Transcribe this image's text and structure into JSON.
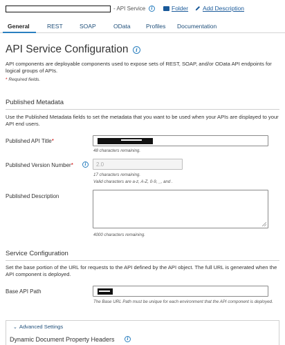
{
  "header": {
    "title_suffix": "- API Service",
    "folder_link": "Folder",
    "add_description_link": "Add Description"
  },
  "tabs": [
    {
      "label": "General",
      "active": true
    },
    {
      "label": "REST"
    },
    {
      "label": "SOAP"
    },
    {
      "label": "OData"
    },
    {
      "label": "Profiles"
    },
    {
      "label": "Documentation"
    }
  ],
  "page": {
    "title": "API Service Configuration",
    "intro": "API components are deployable components used to expose sets of REST, SOAP, and/or OData API endpoints for logical groups of APIs.",
    "required_note": "Required fields."
  },
  "published_metadata": {
    "heading": "Published Metadata",
    "description": "Use the Published Metadata fields to set the metadata that you want to be used when your APIs are displayed to your API end users.",
    "api_title_label": "Published API Title",
    "api_title_hint": "48 characters remaining.",
    "version_label": "Published Version Number",
    "version_value": "2.0",
    "version_hint1": "17 characters remaining.",
    "version_hint2": "Valid characters are a-z, A-Z, 0-9, _, and .",
    "description_label": "Published Description",
    "description_hint": "4000 characters remaining."
  },
  "service_configuration": {
    "heading": "Service Configuration",
    "description": "Set the base portion of the URL for requests to the API defined by the API object. The full URL is generated when the API component is deployed.",
    "base_path_label": "Base API Path",
    "base_path_hint": "The Base URL Path must be unique for each environment that the API component is deployed."
  },
  "advanced": {
    "toggle_label": "Advanced Settings",
    "dynamic_headers_label": "Dynamic Document Property Headers"
  },
  "colors": {
    "link": "#1a5a9a",
    "tab_accent": "#2a7fbf",
    "required_star": "#cc0000"
  }
}
